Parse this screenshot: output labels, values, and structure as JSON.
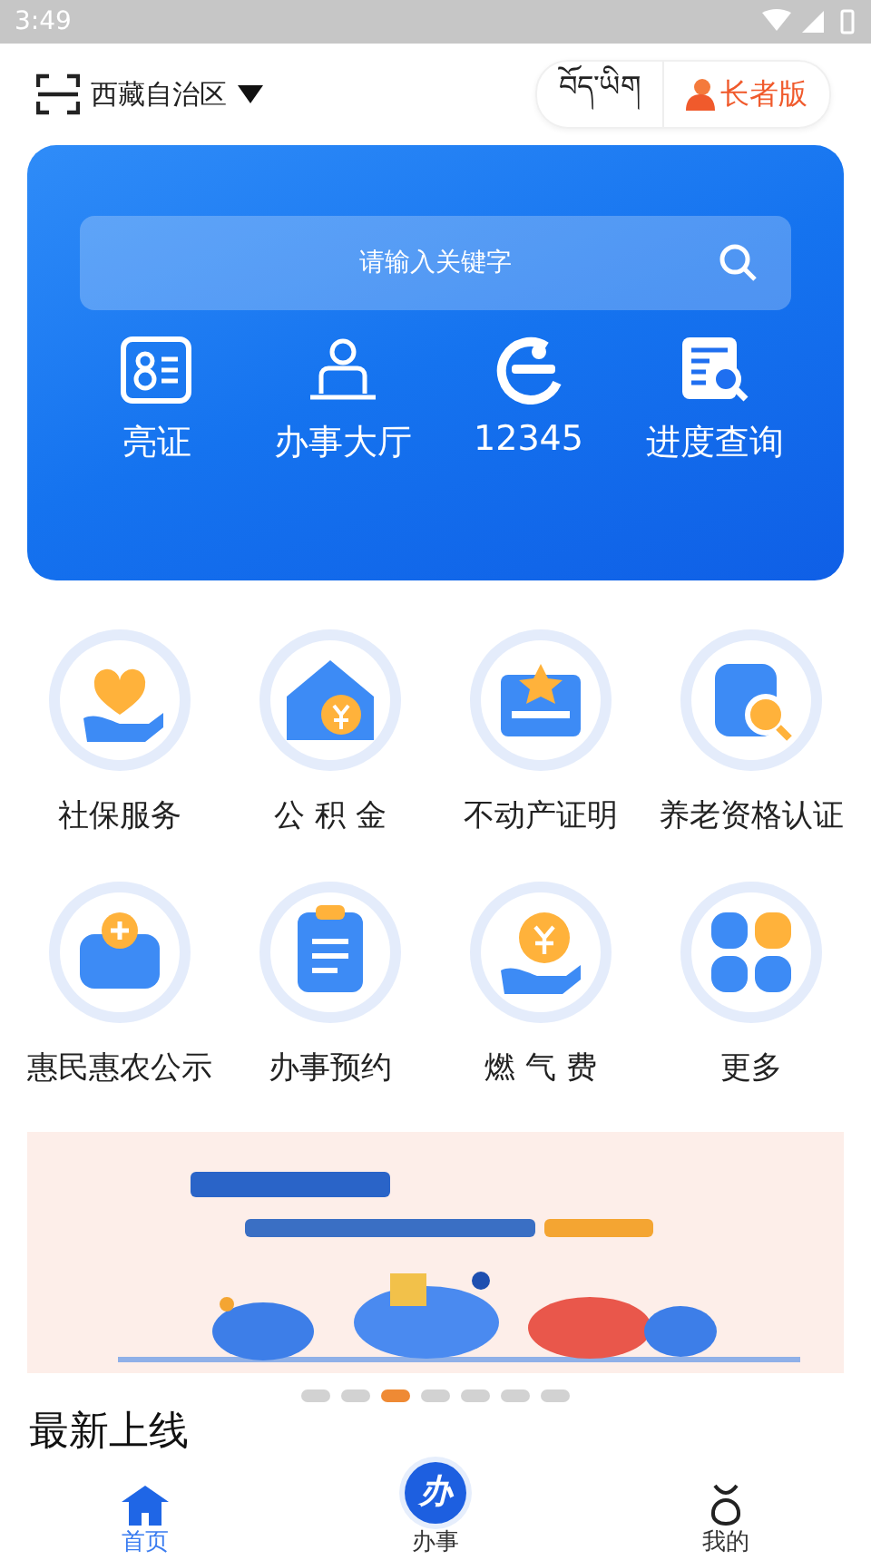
{
  "status_bar": {
    "time": "3:49"
  },
  "header": {
    "region": "西藏自治区",
    "tibetan": "བོད་ཡིག",
    "elder_mode": "长者版"
  },
  "search": {
    "placeholder": "请输入关键字"
  },
  "quick_actions": [
    {
      "label": "亮证"
    },
    {
      "label": "办事大厅"
    },
    {
      "label": "12345"
    },
    {
      "label": "进度查询"
    }
  ],
  "services": [
    {
      "label": "社保服务"
    },
    {
      "label": "公 积 金"
    },
    {
      "label": "不动产证明"
    },
    {
      "label": "养老资格认证"
    },
    {
      "label": "惠民惠农公示"
    },
    {
      "label": "办事预约"
    },
    {
      "label": "燃 气 费"
    },
    {
      "label": "更多"
    }
  ],
  "banner": {
    "kind": "picture",
    "pages": [
      {
        "selected": false
      },
      {
        "selected": false
      },
      {
        "selected": true
      },
      {
        "selected": false
      },
      {
        "selected": false
      },
      {
        "selected": false
      },
      {
        "selected": false
      }
    ]
  },
  "section_title": "最新上线",
  "bottom_nav": [
    {
      "label": "首页",
      "selected": true
    },
    {
      "label": "办事",
      "selected": false,
      "badge": "办"
    },
    {
      "label": "我的",
      "selected": false
    }
  ]
}
